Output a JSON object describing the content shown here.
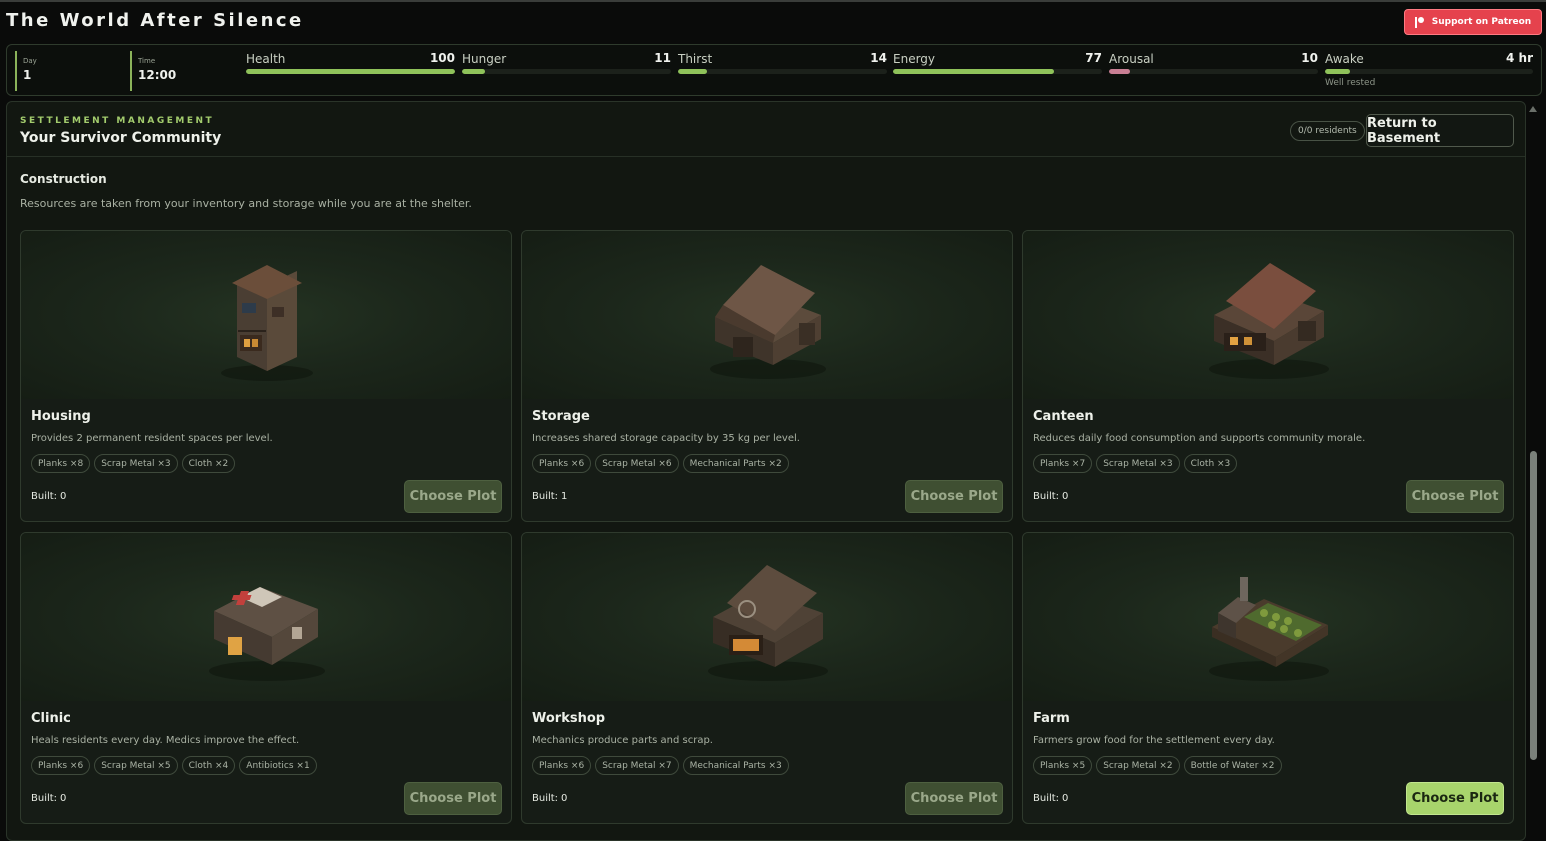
{
  "app": {
    "title": "The World After Silence",
    "patreon_label": "Support on Patreon"
  },
  "status": {
    "day": {
      "label": "Day",
      "value": "1"
    },
    "time": {
      "label": "Time",
      "value": "12:00"
    },
    "meters": [
      {
        "name": "Health",
        "value": "100",
        "fraction": 1.0,
        "color": "#8fc25a"
      },
      {
        "name": "Hunger",
        "value": "11",
        "fraction": 0.11,
        "color": "#8fc25a"
      },
      {
        "name": "Thirst",
        "value": "14",
        "fraction": 0.14,
        "color": "#8fc25a"
      },
      {
        "name": "Energy",
        "value": "77",
        "fraction": 0.77,
        "color": "#8fc25a"
      },
      {
        "name": "Arousal",
        "value": "10",
        "fraction": 0.1,
        "color": "#c97f94"
      },
      {
        "name": "Awake",
        "value": "4 hr",
        "fraction": 0.12,
        "color": "#8fc25a",
        "sub": "Well rested"
      }
    ]
  },
  "settlement": {
    "eyebrow": "SETTLEMENT MANAGEMENT",
    "title": "Your Survivor Community",
    "residents": "0/0 residents",
    "return_label": "Return to Basement"
  },
  "construction": {
    "title": "Construction",
    "description": "Resources are taken from your inventory and storage while you are at the shelter.",
    "built_label": "Built:",
    "buildings": [
      {
        "name": "Housing",
        "desc": "Provides 2 permanent resident spaces per level.",
        "costs": [
          "Planks ×8",
          "Scrap Metal ×3",
          "Cloth ×2"
        ],
        "built": "0",
        "button": "Choose Plot",
        "icon": "housing-building-image"
      },
      {
        "name": "Storage",
        "desc": "Increases shared storage capacity by 35 kg per level.",
        "costs": [
          "Planks ×6",
          "Scrap Metal ×6",
          "Mechanical Parts ×2"
        ],
        "built": "1",
        "button": "Choose Plot",
        "icon": "storage-building-image"
      },
      {
        "name": "Canteen",
        "desc": "Reduces daily food consumption and supports community morale.",
        "costs": [
          "Planks ×7",
          "Scrap Metal ×3",
          "Cloth ×3"
        ],
        "built": "0",
        "button": "Choose Plot",
        "icon": "canteen-building-image"
      },
      {
        "name": "Clinic",
        "desc": "Heals residents every day. Medics improve the effect.",
        "costs": [
          "Planks ×6",
          "Scrap Metal ×5",
          "Cloth ×4",
          "Antibiotics ×1"
        ],
        "built": "0",
        "button": "Choose Plot",
        "icon": "clinic-building-image"
      },
      {
        "name": "Workshop",
        "desc": "Mechanics produce parts and scrap.",
        "costs": [
          "Planks ×6",
          "Scrap Metal ×7",
          "Mechanical Parts ×3"
        ],
        "built": "0",
        "button": "Choose Plot",
        "icon": "workshop-building-image"
      },
      {
        "name": "Farm",
        "desc": "Farmers grow food for the settlement every day.",
        "costs": [
          "Planks ×5",
          "Scrap Metal ×2",
          "Bottle of Water ×2"
        ],
        "built": "0",
        "button": "Choose Plot",
        "icon": "farm-building-image",
        "active": true
      }
    ]
  }
}
